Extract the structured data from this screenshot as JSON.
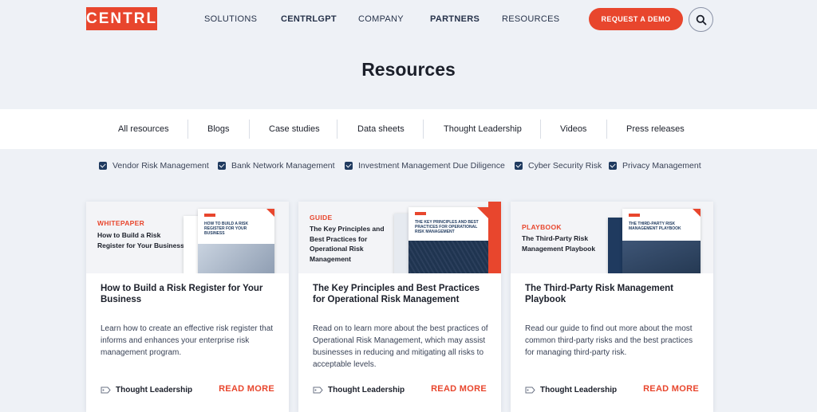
{
  "header": {
    "logo": "CENTRL",
    "nav": [
      "SOLUTIONS",
      "CENTRLGPT",
      "COMPANY",
      "PARTNERS",
      "RESOURCES"
    ],
    "cta": "REQUEST A DEMO",
    "search_icon": "search-icon"
  },
  "page": {
    "title": "Resources"
  },
  "tabs": [
    "All resources",
    "Blogs",
    "Case studies",
    "Data sheets",
    "Thought Leadership",
    "Videos",
    "Press releases"
  ],
  "filters": [
    {
      "label": "Vendor Risk Management",
      "checked": true
    },
    {
      "label": "Bank Network Management",
      "checked": true
    },
    {
      "label": "Investment Management Due Diligence",
      "checked": true
    },
    {
      "label": "Cyber Security Risk",
      "checked": true
    },
    {
      "label": "Privacy Management",
      "checked": true
    }
  ],
  "cards": [
    {
      "type": "WHITEPAPER",
      "image_title": "How to Build a Risk Register for Your Business",
      "doc_title": "HOW TO BUILD A RISK REGISTER FOR YOUR BUSINESS",
      "title": "How to Build a Risk Register for Your Business",
      "description": "Learn how to create an effective risk register that informs and enhances your enterprise risk management program.",
      "tag": "Thought Leadership",
      "read_more": "READ MORE"
    },
    {
      "type": "GUIDE",
      "image_title": "The Key Principles and Best Practices for Operational Risk Management",
      "doc_title": "THE KEY PRINCIPLES AND BEST PRACTICES FOR OPERATIONAL RISK MANAGEMENT",
      "title": "The Key Principles and Best Practices for Operational Risk Management",
      "description": "Read on to learn more about the best practices of Operational Risk Management, which may assist businesses in reducing and mitigating all risks to acceptable levels.",
      "tag": "Thought Leadership",
      "read_more": "READ MORE"
    },
    {
      "type": "PLAYBOOK",
      "image_title": "The Third-Party Risk Management Playbook",
      "doc_title": "THE THIRD-PARTY RISK MANAGEMENT PLAYBOOK",
      "title": "The Third-Party Risk Management Playbook",
      "description": "Read our guide to find out more about the most common third-party risks and the best practices for managing third-party risk.",
      "tag": "Thought Leadership",
      "read_more": "READ MORE"
    }
  ],
  "colors": {
    "accent": "#e8462d",
    "navy": "#1f3a5f",
    "background": "#eef1f6"
  }
}
